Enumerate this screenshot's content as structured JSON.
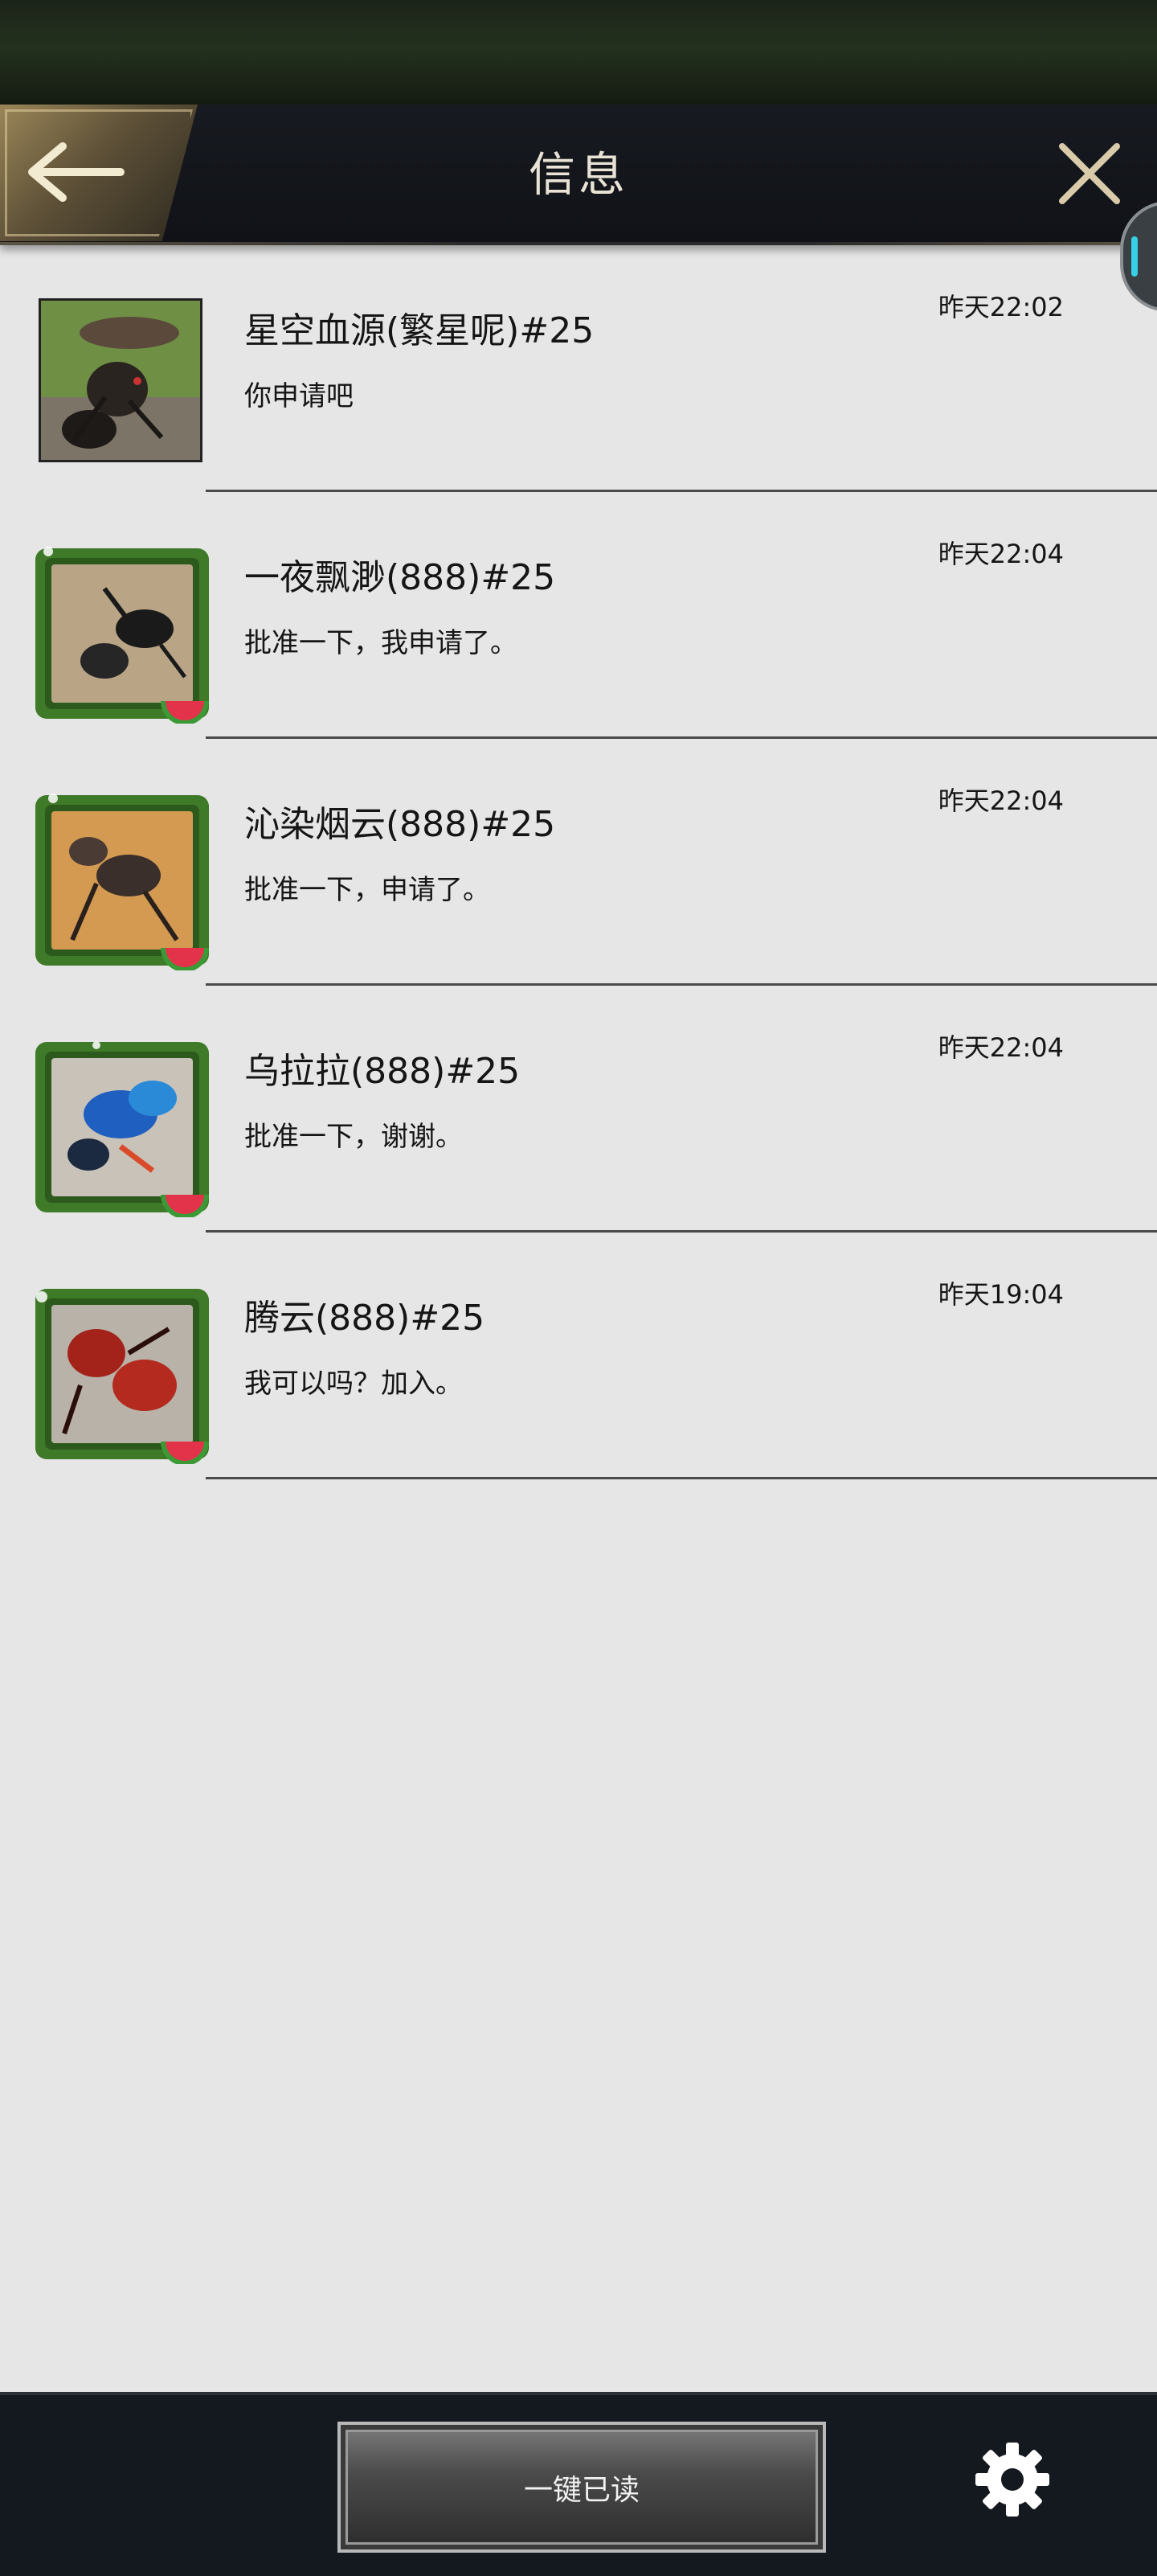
{
  "header": {
    "title": "信息"
  },
  "messages": [
    {
      "name": "星空血源(繁星呢)#25",
      "text": "你申请吧",
      "time": "昨天22:02",
      "avatar_style": "plain"
    },
    {
      "name": "一夜飘渺(888)#25",
      "text": "批准一下，我申请了。",
      "time": "昨天22:04",
      "avatar_style": "leaf-frame"
    },
    {
      "name": "沁染烟云(888)#25",
      "text": "批准一下，申请了。",
      "time": "昨天22:04",
      "avatar_style": "leaf-frame"
    },
    {
      "name": "乌拉拉(888)#25",
      "text": "批准一下，谢谢。",
      "time": "昨天22:04",
      "avatar_style": "leaf-frame"
    },
    {
      "name": "腾云(888)#25",
      "text": "我可以吗？加入。",
      "time": "昨天19:04",
      "avatar_style": "leaf-frame"
    }
  ],
  "footer": {
    "read_all_label": "一键已读"
  },
  "colors": {
    "background": "#e6e6e6",
    "header": "#13161b",
    "accent_gold": "#9a8658",
    "frame_green": "#3f7a28"
  }
}
